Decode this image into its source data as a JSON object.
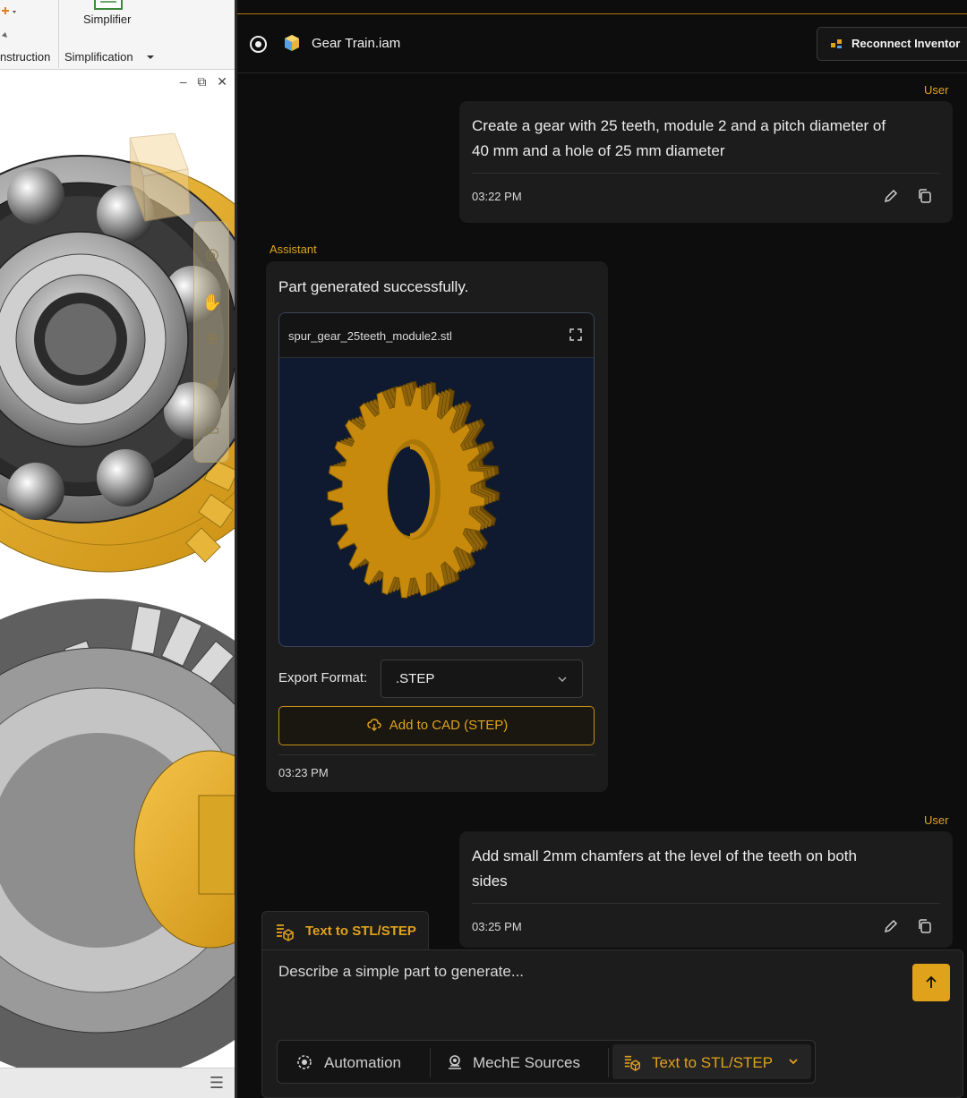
{
  "cad": {
    "ribbon": {
      "tool_label": "Simplifier",
      "group_left_label": "nstruction",
      "group_right_label": "Simplification"
    }
  },
  "header": {
    "file_name": "Gear Train.iam",
    "reconnect_label": "Reconnect Inventor"
  },
  "messages": [
    {
      "role": "User",
      "text_lines": [
        "Create a gear with 25 teeth, module 2 and a pitch diameter of",
        "40 mm and a hole of 25 mm diameter"
      ],
      "time": "03:22 PM"
    },
    {
      "role": "Assistant",
      "text": "Part generated successfully.",
      "viewer": {
        "file_name": "spur_gear_25teeth_module2.stl"
      },
      "export_label": "Export Format:",
      "export_value": ".STEP",
      "add_button_label": "Add to CAD (STEP)",
      "time": "03:23 PM"
    },
    {
      "role": "User",
      "text_lines": [
        "Add small 2mm chamfers at the level of the teeth on both",
        "sides"
      ],
      "time": "03:25 PM"
    }
  ],
  "composer": {
    "mode_tab_label": "Text to STL/STEP",
    "placeholder": "Describe a simple part to generate...",
    "tools": [
      {
        "label": "Automation",
        "icon": "automation-icon"
      },
      {
        "label": "MechE Sources",
        "icon": "sources-icon"
      },
      {
        "label": "Text to STL/STEP",
        "icon": "stl-step-icon"
      }
    ]
  },
  "colors": {
    "accent": "#e0a21b",
    "panel_bg": "#0d0d0d",
    "bubble_bg": "#1c1c1c",
    "viewer_bg": "#0f1a30",
    "gear": "#c88a0c"
  }
}
